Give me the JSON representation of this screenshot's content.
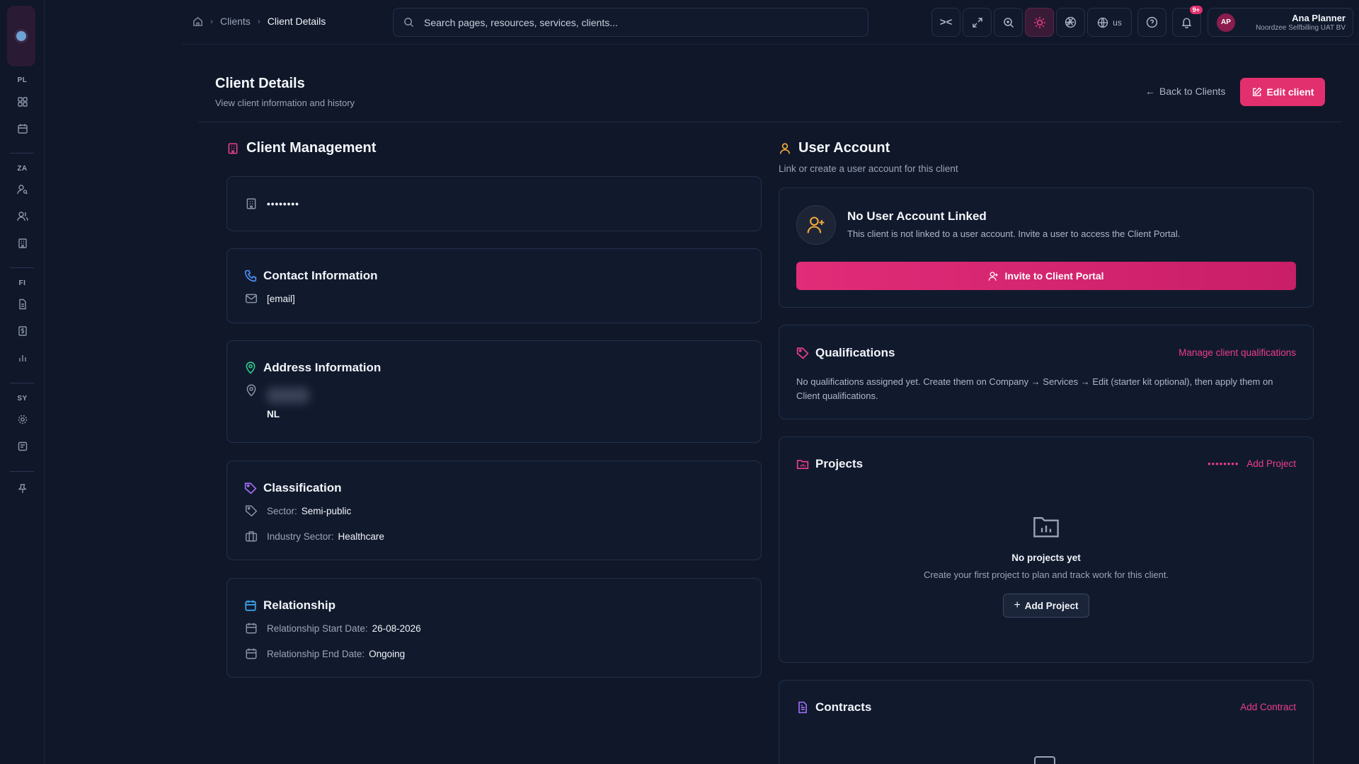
{
  "breadcrumb": {
    "clients": "Clients",
    "current": "Client Details"
  },
  "search": {
    "placeholder": "Search pages, resources, services, clients..."
  },
  "topbar": {
    "lang": "us",
    "notif_count": "9+"
  },
  "user": {
    "initials": "AP",
    "name": "Ana Planner",
    "org": "Noordzee Selfbilling UAT BV"
  },
  "rail": {
    "groups": [
      "PL",
      "ZA",
      "FI",
      "SY"
    ]
  },
  "header": {
    "title": "Client Details",
    "subtitle": "View client information and history",
    "back": "Back to Clients",
    "edit": "Edit client"
  },
  "client_mgmt": {
    "title": "Client Management",
    "name_masked": "••••••••",
    "contact": {
      "title": "Contact Information",
      "email": "[email]"
    },
    "address": {
      "title": "Address Information",
      "country": "NL"
    },
    "classification": {
      "title": "Classification",
      "sector_label": "Sector:",
      "sector": "Semi-public",
      "industry_label": "Industry Sector:",
      "industry": "Healthcare"
    },
    "relationship": {
      "title": "Relationship",
      "start_label": "Relationship Start Date:",
      "start": "26-08-2026",
      "end_label": "Relationship End Date:",
      "end": "Ongoing"
    }
  },
  "user_account": {
    "title": "User Account",
    "subtitle": "Link or create a user account for this client",
    "status_title": "No User Account Linked",
    "status_text": "This client is not linked to a user account. Invite a user to access the Client Portal.",
    "invite": "Invite to Client Portal"
  },
  "qualifications": {
    "title": "Qualifications",
    "manage": "Manage client qualifications",
    "text": "No qualifications assigned yet. Create them on Company → Services → Edit (starter kit optional), then apply them on Client qualifications."
  },
  "projects": {
    "title": "Projects",
    "masked": "••••••••",
    "add_link": "Add Project",
    "empty_title": "No projects yet",
    "empty_text": "Create your first project to plan and track work for this client.",
    "add_button": "Add Project"
  },
  "contracts": {
    "title": "Contracts",
    "add_link": "Add Contract"
  },
  "colors": {
    "accent": "#e2306e",
    "bg": "#0f1729",
    "card": "#111a2d"
  }
}
